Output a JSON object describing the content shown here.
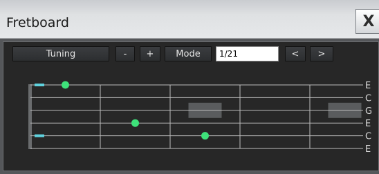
{
  "window": {
    "title": "Fretboard",
    "close_glyph": "X"
  },
  "toolbar": {
    "tuning_label": "Tuning",
    "minus_label": "-",
    "plus_label": "+",
    "mode_label": "Mode",
    "position_value": "1/21",
    "prev_label": "<",
    "next_label": ">"
  },
  "fretboard": {
    "strings": [
      "E",
      "C",
      "G",
      "E",
      "C",
      "E"
    ],
    "frets_visible": 5,
    "notes": [
      {
        "string": 0,
        "fret": 0,
        "type": "open"
      },
      {
        "string": 0,
        "fret": 1,
        "type": "dot"
      },
      {
        "string": 3,
        "fret": 2,
        "type": "dot"
      },
      {
        "string": 4,
        "fret": 3,
        "type": "dot"
      },
      {
        "string": 4,
        "fret": 0,
        "type": "open"
      }
    ],
    "highlights": [
      {
        "string": 2,
        "fret": 3
      },
      {
        "string": 2,
        "fret": 5
      }
    ],
    "colors": {
      "note": "#3ee27a",
      "open": "#5fd3df",
      "highlight": "#5a5c5e",
      "line": "#bdbdbd",
      "label": "#dcdcdc"
    }
  }
}
